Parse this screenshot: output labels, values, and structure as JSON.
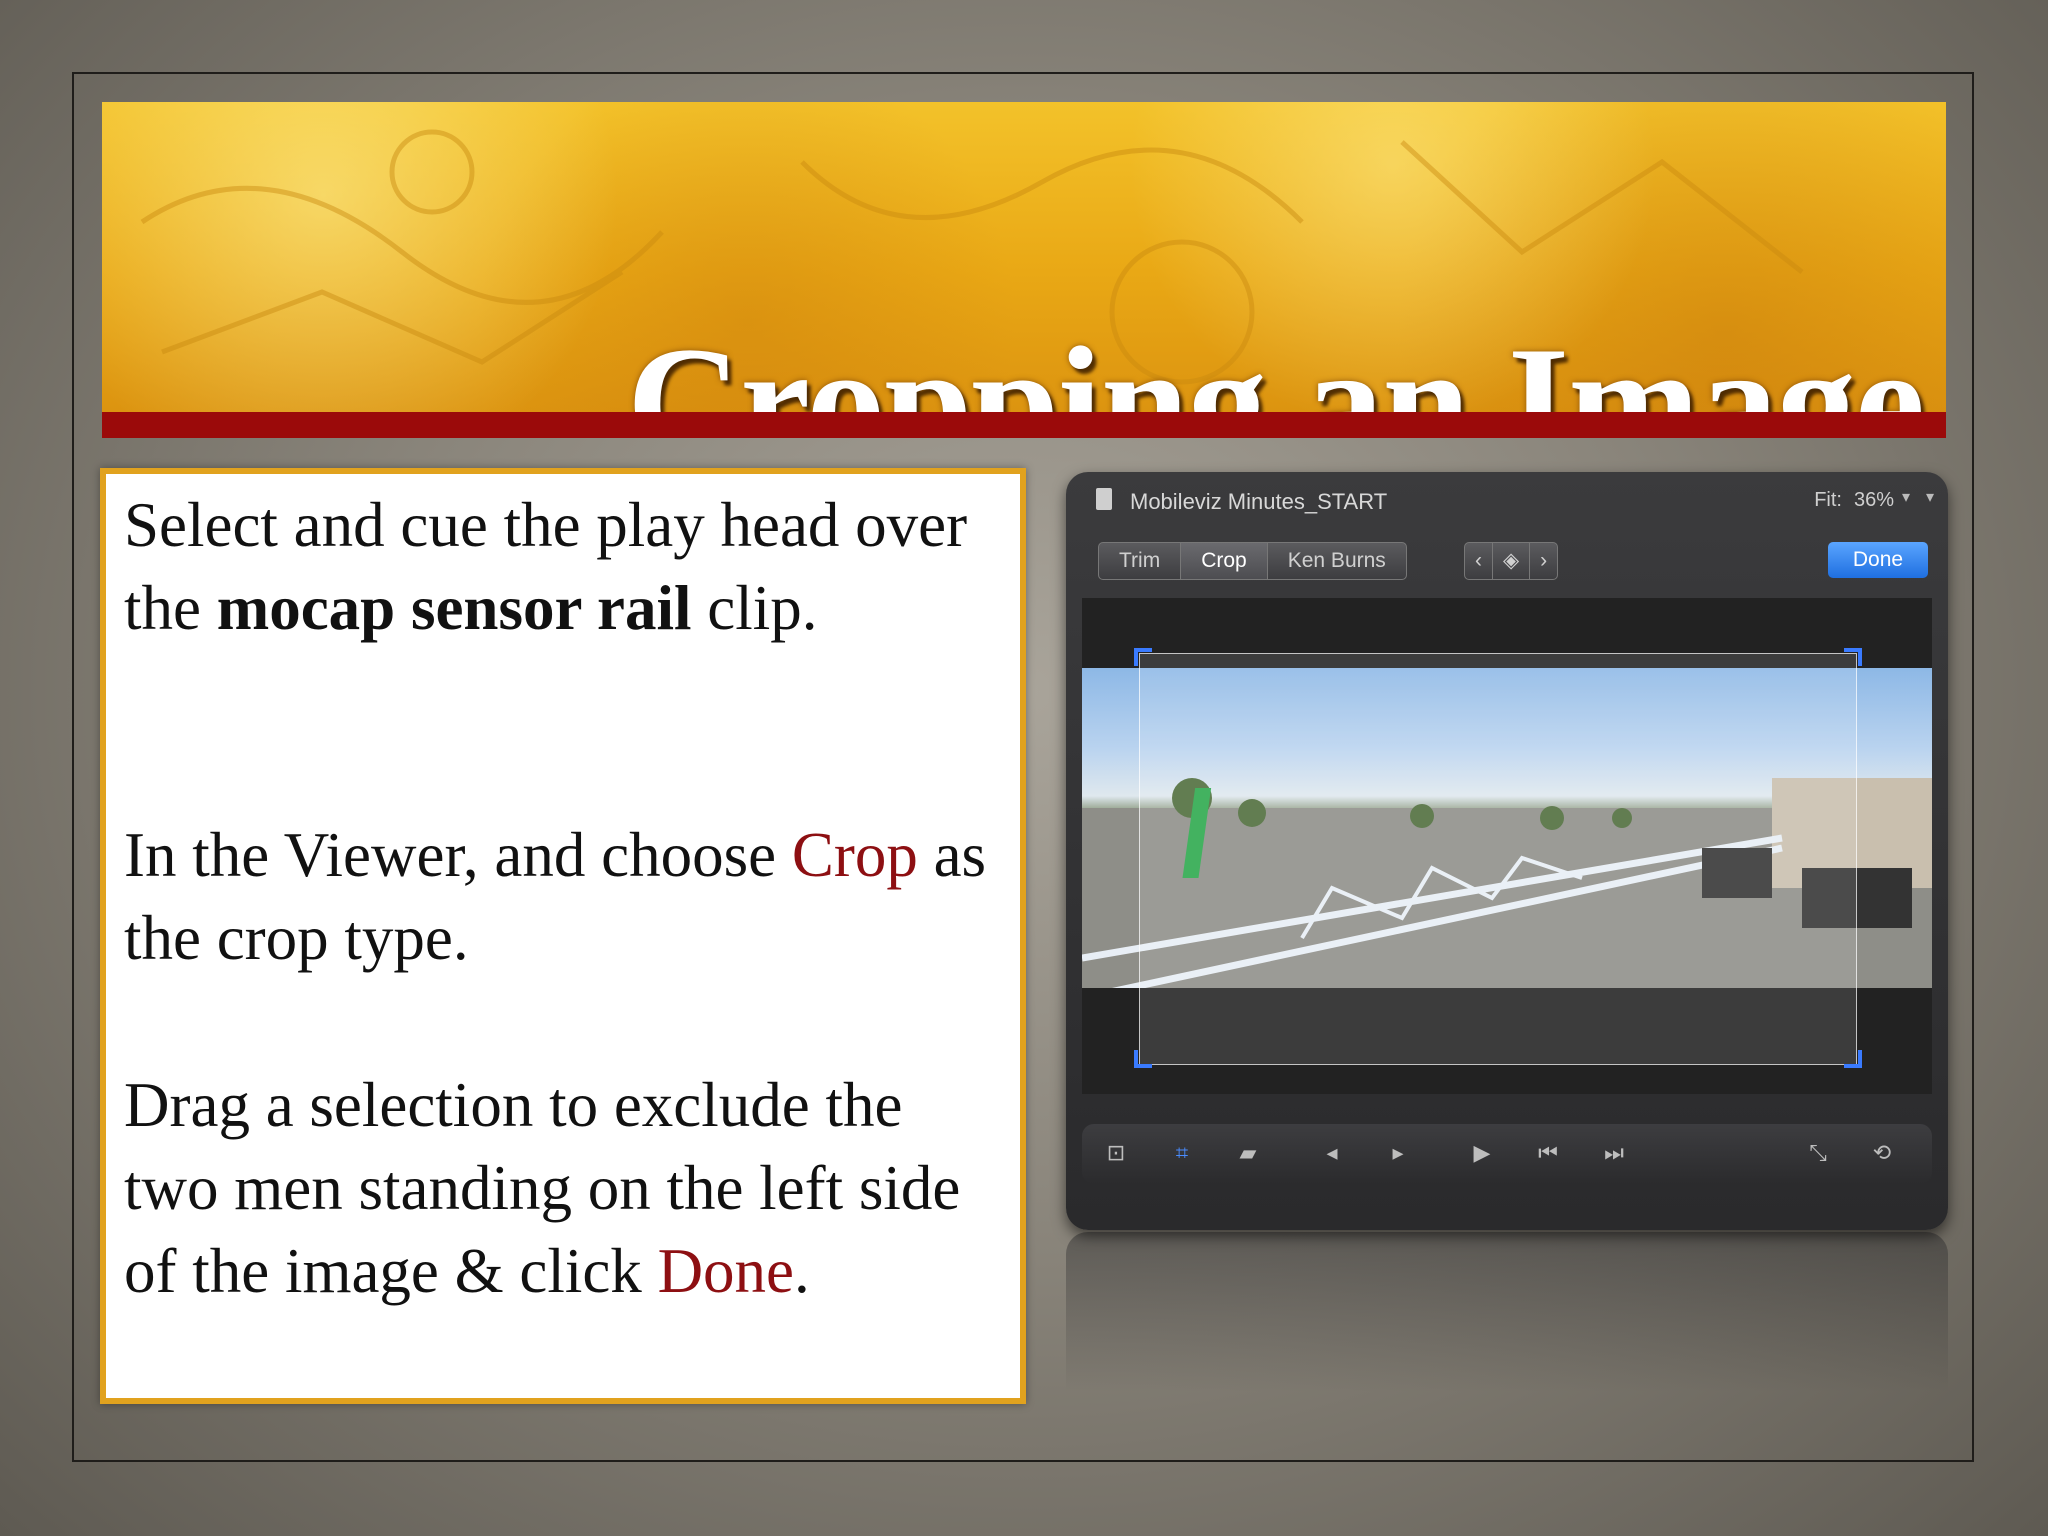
{
  "slide": {
    "title": "Cropping an Image",
    "paragraphs": {
      "p1": {
        "a": "Select and cue the play head over the ",
        "b": "mocap sensor rail",
        "c": " clip."
      },
      "p2": {
        "a": "In the Viewer, and choose ",
        "b": "Crop",
        "c": " as the crop type."
      },
      "p3": {
        "a": "Drag a selection to exclude the two men standing on the left side of the image & click ",
        "b": "Done",
        "c": "."
      }
    },
    "colors": {
      "banner": "#e9a815",
      "bar": "#9b0a0a",
      "border": "#e1a21e",
      "highlight": "#8d0f12"
    }
  },
  "viewer": {
    "title": "Mobileviz Minutes_START",
    "fit_label": "Fit:",
    "fit_value": "36%",
    "tabs": [
      "Trim",
      "Crop",
      "Ken Burns"
    ],
    "active_tab": "Crop",
    "done_label": "Done",
    "toolbar_icons": [
      "crop-overlay-icon",
      "crop-icon",
      "distort-icon",
      "prev-frame-icon",
      "next-frame-icon",
      "play-icon",
      "go-to-start-icon",
      "go-to-end-icon",
      "fullscreen-icon",
      "loop-icon"
    ]
  }
}
